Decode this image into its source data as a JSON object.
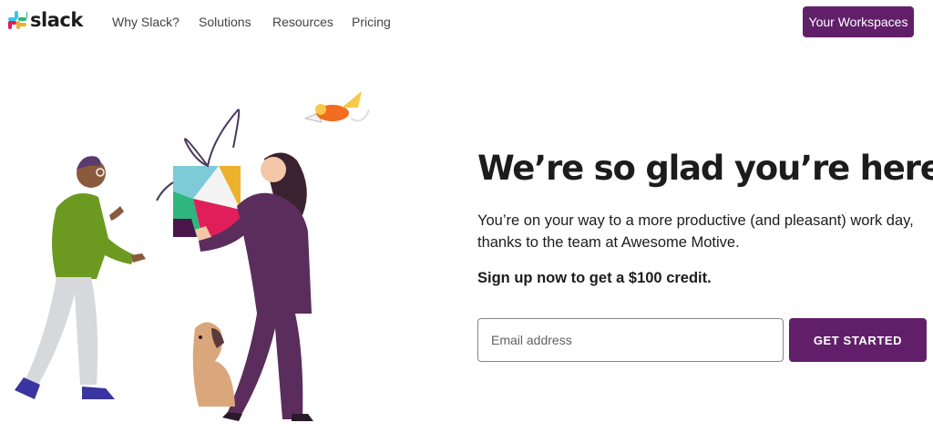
{
  "nav": {
    "logo_text": "slack",
    "links": [
      "Why Slack?",
      "Solutions",
      "Resources",
      "Pricing"
    ],
    "workspaces_button": "Your Workspaces"
  },
  "hero": {
    "headline": "We’re so glad you’re here.",
    "subtext": "You’re on your way to a more productive (and pleasant) work day, thanks to the team at Awesome Motive.",
    "offer": "Sign up now to get a $100 credit.",
    "email_placeholder": "Email address",
    "email_value": "",
    "cta_label": "GET STARTED"
  },
  "colors": {
    "brand_purple": "#611f69",
    "text": "#1d1c1d",
    "slack_blue": "#36c5f0",
    "slack_green": "#2eb67d",
    "slack_yellow": "#ecb22e",
    "slack_red": "#e01e5a"
  }
}
